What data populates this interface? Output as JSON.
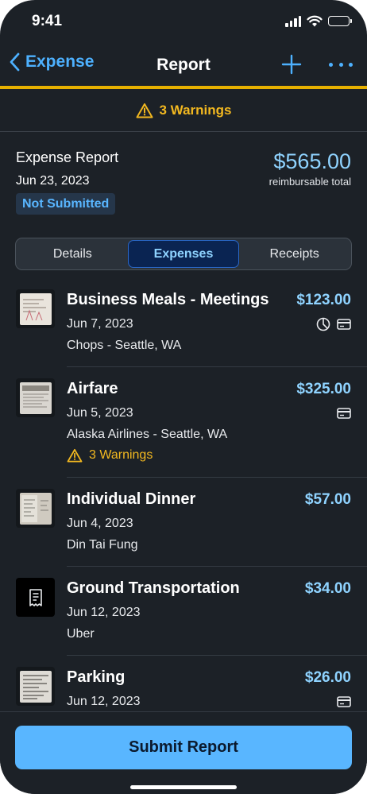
{
  "status_bar": {
    "time": "9:41"
  },
  "nav": {
    "back_label": "Expense",
    "title": "Report",
    "add_icon": "plus-icon",
    "more_icon": "more-icon"
  },
  "warnings_banner": {
    "text": "3 Warnings",
    "icon": "warning-icon"
  },
  "summary": {
    "report_name": "Expense Report",
    "date": "Jun 23, 2023",
    "status": "Not Submitted",
    "total_amount": "$565.00",
    "total_label": "reimbursable total"
  },
  "tabs": [
    {
      "label": "Details",
      "active": false
    },
    {
      "label": "Expenses",
      "active": true
    },
    {
      "label": "Receipts",
      "active": false
    }
  ],
  "expenses": [
    {
      "title": "Business Meals - Meetings",
      "amount": "$123.00",
      "date": "Jun 7, 2023",
      "vendor": "Chops - Seattle, WA",
      "icons": [
        "pie-chart-icon",
        "credit-card-icon"
      ],
      "thumbnail": "receipt-image"
    },
    {
      "title": "Airfare",
      "amount": "$325.00",
      "date": "Jun 5, 2023",
      "vendor": "Alaska Airlines - Seattle, WA",
      "warning": "3 Warnings",
      "icons": [
        "credit-card-icon"
      ],
      "thumbnail": "receipt-image"
    },
    {
      "title": "Individual Dinner",
      "amount": "$57.00",
      "date": "Jun 4, 2023",
      "vendor": "Din Tai Fung",
      "icons": [],
      "thumbnail": "receipt-image"
    },
    {
      "title": "Ground Transportation",
      "amount": "$34.00",
      "date": "Jun 12, 2023",
      "vendor": "Uber",
      "icons": [],
      "thumbnail": "receipt-icon"
    },
    {
      "title": "Parking",
      "amount": "$26.00",
      "date": "Jun 12, 2023",
      "icons": [
        "credit-card-icon"
      ],
      "thumbnail": "receipt-image"
    }
  ],
  "submit_label": "Submit Report",
  "colors": {
    "background": "#1c2127",
    "accent": "#4db1ff",
    "amount": "#8fd3ff",
    "warning": "#f2b820",
    "nav_underline": "#e6b000",
    "submit": "#59b6ff"
  }
}
